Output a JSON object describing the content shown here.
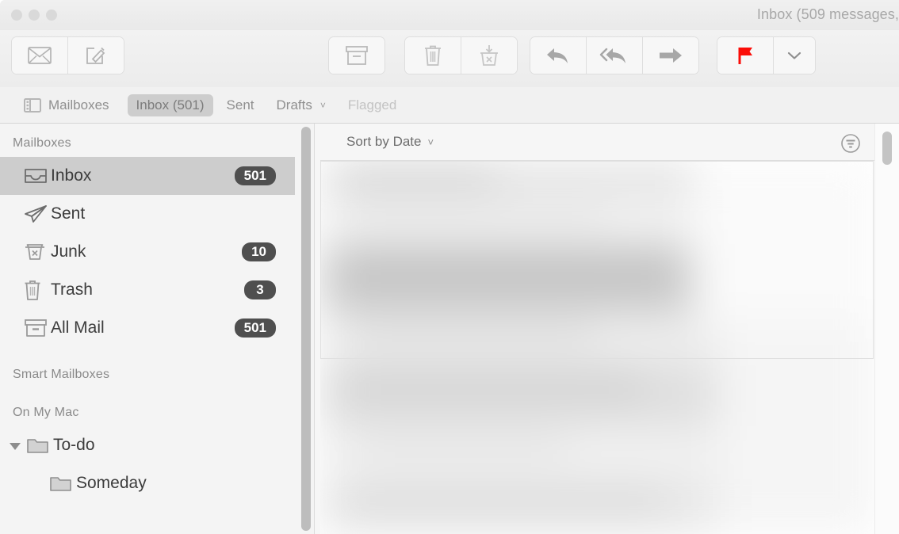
{
  "window": {
    "title": "Inbox (509 messages,",
    "traffic_lights": [
      "close",
      "minimize",
      "zoom"
    ],
    "traffic_state": "inactive"
  },
  "toolbar": {
    "groups": [
      {
        "name": "mail-actions",
        "buttons": [
          {
            "name": "get-mail-button",
            "icon": "envelope-icon",
            "label": "Get Mail"
          },
          {
            "name": "compose-button",
            "icon": "compose-icon",
            "label": "New Message"
          }
        ]
      },
      {
        "name": "archive-group",
        "buttons": [
          {
            "name": "archive-button",
            "icon": "archive-box-icon",
            "label": "Archive"
          }
        ]
      },
      {
        "name": "delete-group",
        "buttons": [
          {
            "name": "delete-button",
            "icon": "trash-icon",
            "label": "Delete"
          },
          {
            "name": "junk-button",
            "icon": "junk-basket-icon",
            "label": "Junk"
          }
        ]
      },
      {
        "name": "reply-group",
        "buttons": [
          {
            "name": "reply-button",
            "icon": "reply-arrow-icon",
            "label": "Reply"
          },
          {
            "name": "reply-all-button",
            "icon": "reply-all-arrow-icon",
            "label": "Reply All"
          },
          {
            "name": "forward-button",
            "icon": "forward-arrow-icon",
            "label": "Forward"
          }
        ]
      },
      {
        "name": "flag-group",
        "buttons": [
          {
            "name": "flag-button",
            "icon": "flag-icon",
            "label": "Flag"
          },
          {
            "name": "flag-dropdown-button",
            "icon": "chevron-down-icon",
            "label": "Flag options"
          }
        ]
      }
    ],
    "flag_color": "#fb0d08"
  },
  "favorites_bar": {
    "sidebar_toggle": {
      "icon": "sidebar-toggle-icon",
      "label": "Mailboxes"
    },
    "items": [
      {
        "label": "Inbox (501)",
        "state": "selected"
      },
      {
        "label": "Sent",
        "state": "normal"
      },
      {
        "label": "Drafts",
        "state": "normal",
        "chevron": "˅"
      },
      {
        "label": "Flagged",
        "state": "dimmed"
      }
    ]
  },
  "sidebar": {
    "sections": [
      {
        "header": "Mailboxes",
        "rows": [
          {
            "label": "Inbox",
            "icon": "inbox-tray-icon",
            "badge": "501",
            "selected": true
          },
          {
            "label": "Sent",
            "icon": "paper-plane-icon",
            "badge": "",
            "selected": false
          },
          {
            "label": "Junk",
            "icon": "junk-basket-icon",
            "badge": "10",
            "selected": false
          },
          {
            "label": "Trash",
            "icon": "trash-icon",
            "badge": "3",
            "selected": false
          },
          {
            "label": "All Mail",
            "icon": "archive-box-icon",
            "badge": "501",
            "selected": false
          }
        ]
      },
      {
        "header": "Smart Mailboxes",
        "rows": []
      },
      {
        "header": "On My Mac",
        "rows": [
          {
            "label": "To-do",
            "icon": "folder-icon",
            "badge": "",
            "selected": false,
            "disclosure": "open"
          },
          {
            "label": "Someday",
            "icon": "folder-icon",
            "badge": "",
            "selected": false,
            "indent": true
          }
        ]
      }
    ],
    "badge_color": "#4f4f4f",
    "selection_color": "#cdcdcd"
  },
  "message_list": {
    "sort_label": "Sort by Date",
    "sort_chevron": "˅",
    "filter_icon": "filter-icon",
    "content_state": "blurred",
    "scrollbar": {
      "name": "list-scrollbar",
      "thumb_position": "top"
    }
  }
}
